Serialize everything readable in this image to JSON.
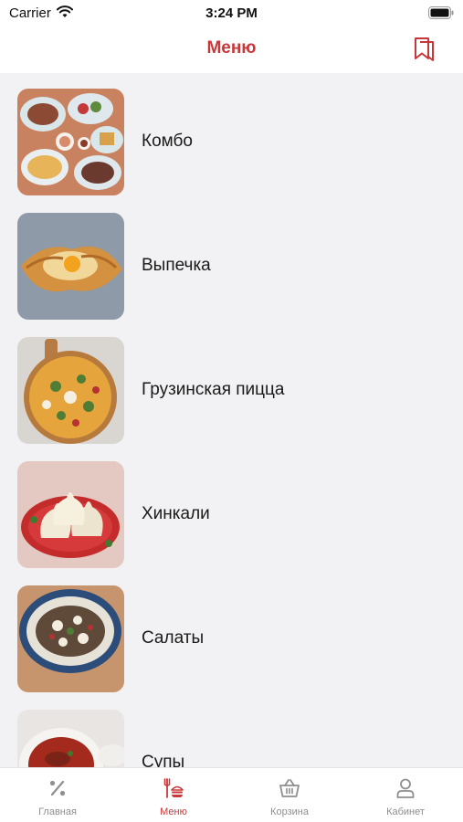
{
  "status_bar": {
    "carrier": "Carrier",
    "time": "3:24 PM"
  },
  "header": {
    "title": "Меню"
  },
  "categories": [
    {
      "label": "Комбо",
      "icon": "combo-food-image"
    },
    {
      "label": "Выпечка",
      "icon": "khachapuri-image"
    },
    {
      "label": "Грузинская пицца",
      "icon": "pizza-image"
    },
    {
      "label": "Хинкали",
      "icon": "khinkali-image"
    },
    {
      "label": "Салаты",
      "icon": "salad-image"
    },
    {
      "label": "Супы",
      "icon": "soup-image"
    }
  ],
  "tabs": [
    {
      "label": "Главная",
      "icon": "percent-icon",
      "active": false
    },
    {
      "label": "Меню",
      "icon": "menu-food-icon",
      "active": true
    },
    {
      "label": "Корзина",
      "icon": "basket-icon",
      "active": false
    },
    {
      "label": "Кабинет",
      "icon": "person-icon",
      "active": false
    }
  ],
  "colors": {
    "accent": "#c8383a",
    "inactive": "#8e8e93",
    "background": "#f2f2f4"
  }
}
